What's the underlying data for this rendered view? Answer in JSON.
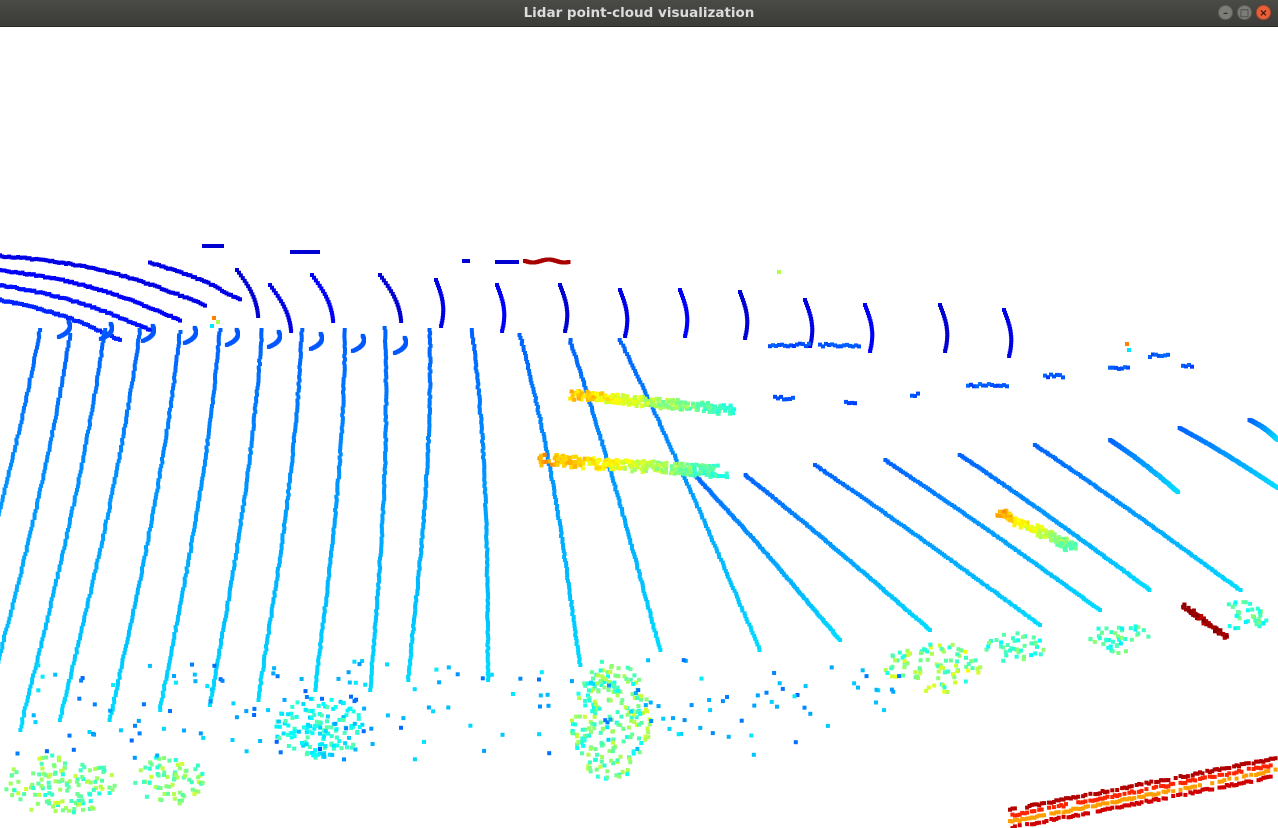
{
  "window": {
    "title": "Lidar point-cloud visualization",
    "controls": {
      "minimize_icon": "minimize-icon",
      "maximize_icon": "maximize-icon",
      "close_icon": "close-icon"
    }
  },
  "viewport": {
    "background": "#ffffff",
    "colormap": "jet",
    "colormap_stops": [
      "#00007f",
      "#0000ff",
      "#0080ff",
      "#00ffff",
      "#80ff80",
      "#ffff00",
      "#ff8000",
      "#ff0000",
      "#7f0000"
    ]
  }
}
